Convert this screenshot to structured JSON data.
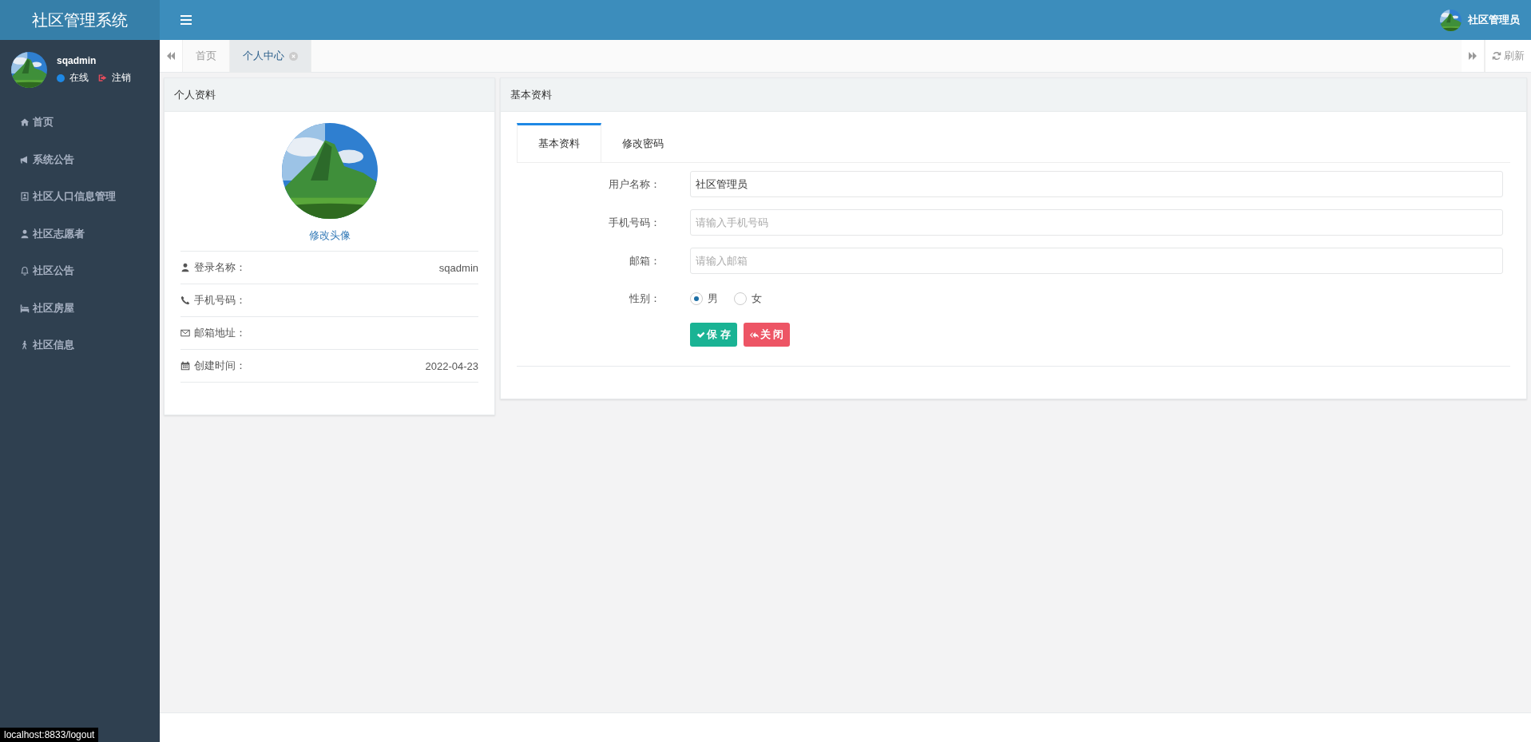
{
  "header": {
    "brand": "社区管理系统",
    "user_name": "社区管理员"
  },
  "sidebar": {
    "user": {
      "name": "sqadmin",
      "status": "在线",
      "logout": "注销"
    },
    "items": [
      {
        "kind": "home",
        "label": "首页"
      },
      {
        "kind": "bullhorn",
        "label": "系统公告"
      },
      {
        "kind": "contact",
        "label": "社区人口信息管理"
      },
      {
        "kind": "user",
        "label": "社区志愿者"
      },
      {
        "kind": "bell",
        "label": "社区公告"
      },
      {
        "kind": "bed",
        "label": "社区房屋"
      },
      {
        "kind": "walk",
        "label": "社区信息"
      }
    ]
  },
  "page_tabs": [
    {
      "label": "首页",
      "selected": false,
      "closable": false
    },
    {
      "label": "个人中心",
      "selected": true,
      "closable": true
    }
  ],
  "refresh": "刷新",
  "profile_card": {
    "title": "个人资料",
    "change_avatar": "修改头像",
    "rows": [
      {
        "kind": "user",
        "label": "登录名称：",
        "value": "sqadmin"
      },
      {
        "kind": "phone",
        "label": "手机号码："
      },
      {
        "kind": "mail",
        "label": "邮箱地址："
      },
      {
        "kind": "calendar",
        "label": "创建时间：",
        "value": "2022-04-23"
      }
    ]
  },
  "form_card": {
    "title": "基本资料",
    "tabs": [
      {
        "label": "基本资料",
        "selected": true
      },
      {
        "label": "修改密码",
        "selected": false
      }
    ],
    "fields": [
      {
        "label": "用户名称：",
        "value": "社区管理员"
      },
      {
        "label": "手机号码：",
        "placeholder": "请输入手机号码"
      },
      {
        "label": "邮箱：",
        "placeholder": "请输入邮箱"
      }
    ],
    "gender": {
      "label": "性别：",
      "options": [
        {
          "label": "男",
          "selected": true
        },
        {
          "label": "女",
          "selected": false
        }
      ]
    },
    "buttons": [
      {
        "kind": "save",
        "label": "保 存"
      },
      {
        "kind": "close",
        "label": "关 闭"
      }
    ]
  },
  "status_tooltip": "localhost:8833/logout"
}
